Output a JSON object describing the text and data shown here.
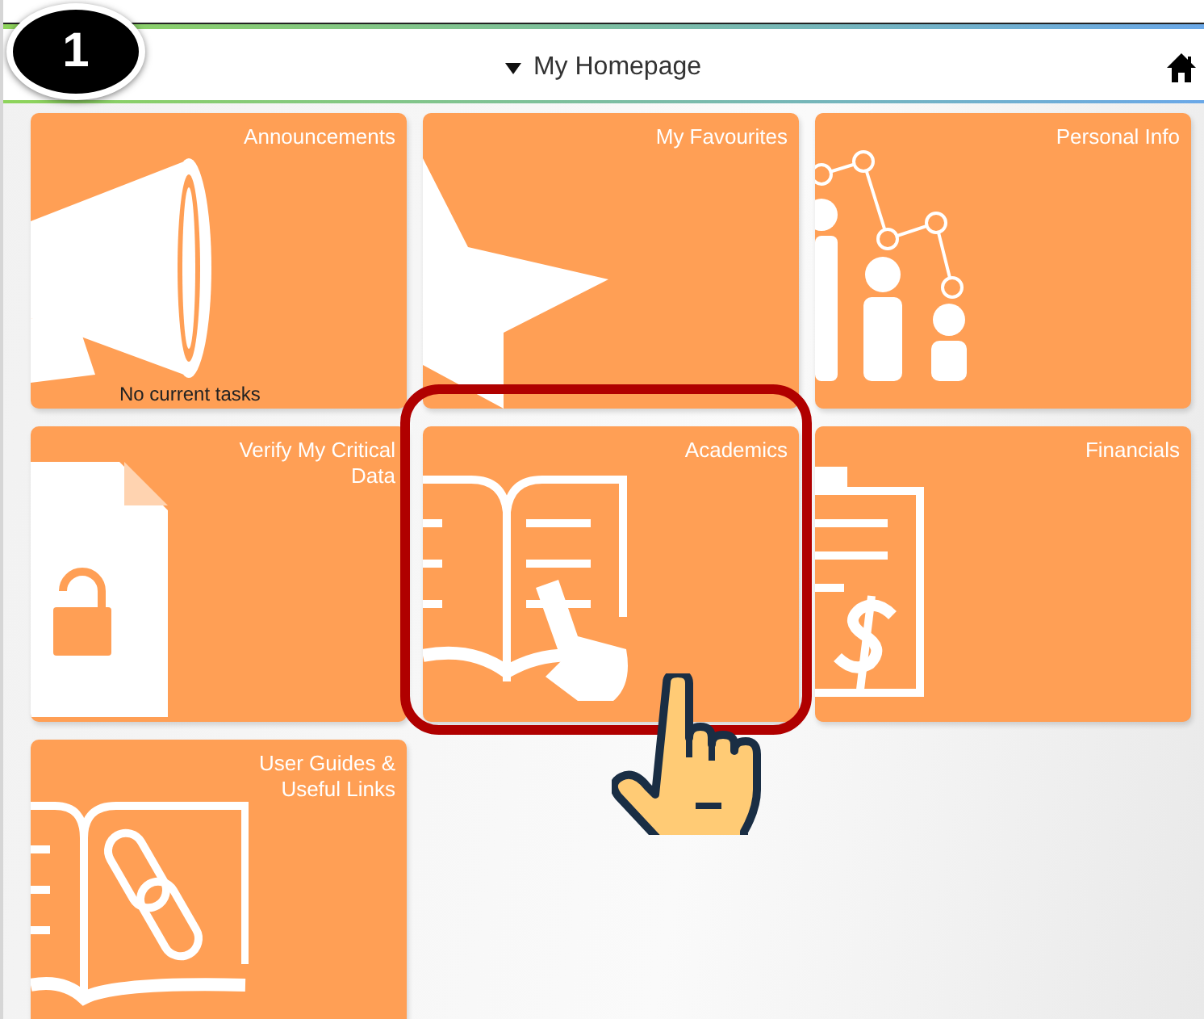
{
  "step_marker": "1",
  "header": {
    "title": "My Homepage"
  },
  "tiles": [
    {
      "title": "Announcements",
      "kind": "megaphone",
      "status": "No current tasks",
      "highlighted": false
    },
    {
      "title": "My Favourites",
      "kind": "star",
      "highlighted": false
    },
    {
      "title": "Personal Info",
      "kind": "people",
      "highlighted": false
    },
    {
      "title": "Verify My Critical Data",
      "kind": "lockdoc",
      "highlighted": false
    },
    {
      "title": "Academics",
      "kind": "book",
      "highlighted": true
    },
    {
      "title": "Financials",
      "kind": "clipboard",
      "highlighted": false
    },
    {
      "title": "User Guides & Useful Links",
      "kind": "linkbook",
      "highlighted": false
    }
  ]
}
